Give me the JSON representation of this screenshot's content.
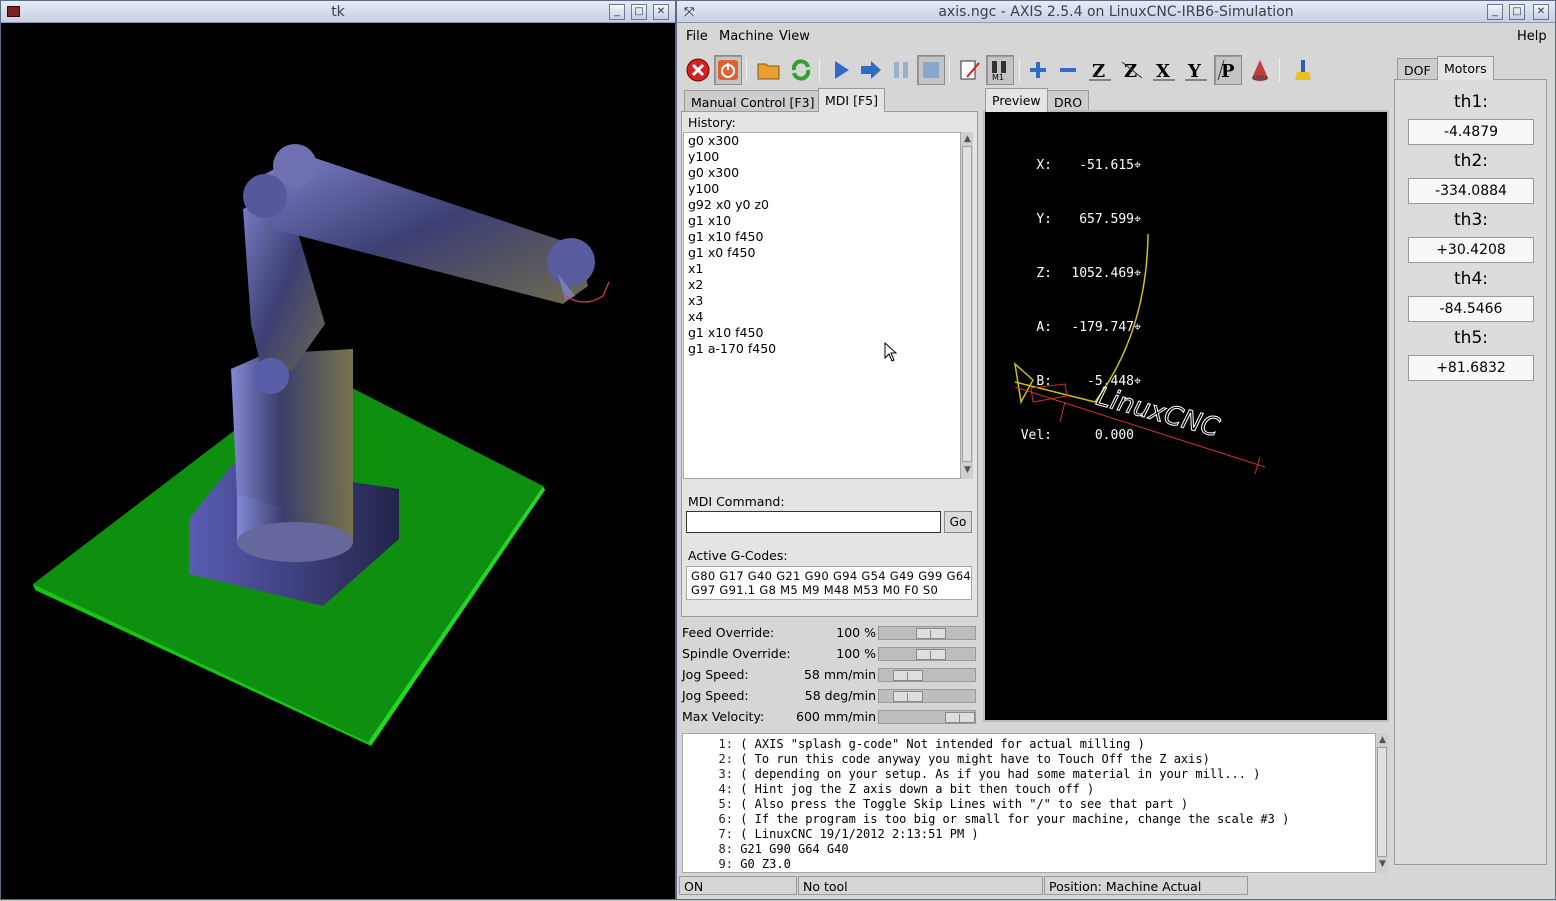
{
  "tk_window": {
    "title": "tk"
  },
  "axis_window": {
    "title": "axis.ngc - AXIS 2.5.4 on LinuxCNC-IRB6-Simulation"
  },
  "menu": {
    "file": "File",
    "machine": "Machine",
    "view": "View",
    "help": "Help"
  },
  "toolbar_icons": [
    "estop-icon",
    "power-icon",
    "open-file-icon",
    "reload-icon",
    "run-icon",
    "step-icon",
    "pause-icon",
    "stop-icon",
    "skip-lines-icon",
    "optional-stop-icon",
    "zoom-in-icon",
    "zoom-out-icon",
    "view-z-icon",
    "view-z2-icon",
    "view-x-icon",
    "view-y-icon",
    "view-p-icon",
    "rotate-icon",
    "clear-plot-icon"
  ],
  "left_tabs": {
    "manual": "Manual Control [F3]",
    "mdi": "MDI [F5]"
  },
  "mdi": {
    "history_label": "History:",
    "history": [
      "g0 x300",
      "y100",
      "g0 x300",
      "y100",
      "g92 x0 y0 z0",
      "g1 x10",
      "g1 x10 f450",
      "g1 x0 f450",
      "x1",
      "x2",
      "x3",
      "x4",
      "g1 x10 f450",
      "g1 a-170 f450"
    ],
    "command_label": "MDI Command:",
    "command_value": "",
    "go": "Go",
    "active_label": "Active G-Codes:",
    "active_line1": "G80 G17 G40 G21 G90 G94 G54 G49 G99 G64",
    "active_line2": "G97 G91.1 G8 M5 M9 M48 M53 M0 F0 S0"
  },
  "overrides": [
    {
      "label": "Feed Override:",
      "value": "100 %",
      "level": 0.5
    },
    {
      "label": "Spindle Override:",
      "value": "100 %",
      "level": 0.5
    },
    {
      "label": "Jog Speed:",
      "value": "58 mm/min",
      "level": 0.1
    },
    {
      "label": "Jog Speed:",
      "value": "58 deg/min",
      "level": 0.1
    },
    {
      "label": "Max Velocity:",
      "value": "600 mm/min",
      "level": 1.0
    }
  ],
  "view_tabs": {
    "preview": "Preview",
    "dro": "DRO"
  },
  "dro": {
    "x_label": "X:",
    "x": "-51.615",
    "y_label": "Y:",
    "y": "657.599",
    "z_label": "Z:",
    "z": "1052.469",
    "a_label": "A:",
    "a": "-179.747",
    "b_label": "B:",
    "b": "-5.448",
    "vel_label": "Vel:",
    "vel": "0.000"
  },
  "preview_logo": "LinuxCNC",
  "right_tabs": {
    "dof": "DOF",
    "motors": "Motors"
  },
  "motors": [
    {
      "label": "th1:",
      "value": "-4.4879"
    },
    {
      "label": "th2:",
      "value": "-334.0884"
    },
    {
      "label": "th3:",
      "value": "+30.4208"
    },
    {
      "label": "th4:",
      "value": "-84.5466"
    },
    {
      "label": "th5:",
      "value": "+81.6832"
    }
  ],
  "gcode": [
    {
      "n": "1:",
      "text": "( AXIS \"splash g-code\" Not intended for actual milling )"
    },
    {
      "n": "2:",
      "text": "( To run this code anyway you might have to Touch Off the Z axis)"
    },
    {
      "n": "3:",
      "text": "( depending on your setup. As if you had some material in your mill... )"
    },
    {
      "n": "4:",
      "text": "( Hint jog the Z axis down a bit then touch off )"
    },
    {
      "n": "5:",
      "text": "( Also press the Toggle Skip Lines with \"/\" to see that part )"
    },
    {
      "n": "6:",
      "text": "( If the program is too big or small for your machine, change the scale #3 )"
    },
    {
      "n": "7:",
      "text": "( LinuxCNC 19/1/2012 2:13:51 PM )"
    },
    {
      "n": "8:",
      "text": "G21 G90 G64 G40"
    },
    {
      "n": "9:",
      "text": "G0 Z3.0"
    }
  ],
  "status": {
    "machine": "ON",
    "tool": "No tool",
    "position": "Position: Machine Actual"
  },
  "colors": {
    "plot_line": "#c8c020",
    "ground": "#1fa31f",
    "robot": "#4a4e8a",
    "estop": "#d42020"
  }
}
